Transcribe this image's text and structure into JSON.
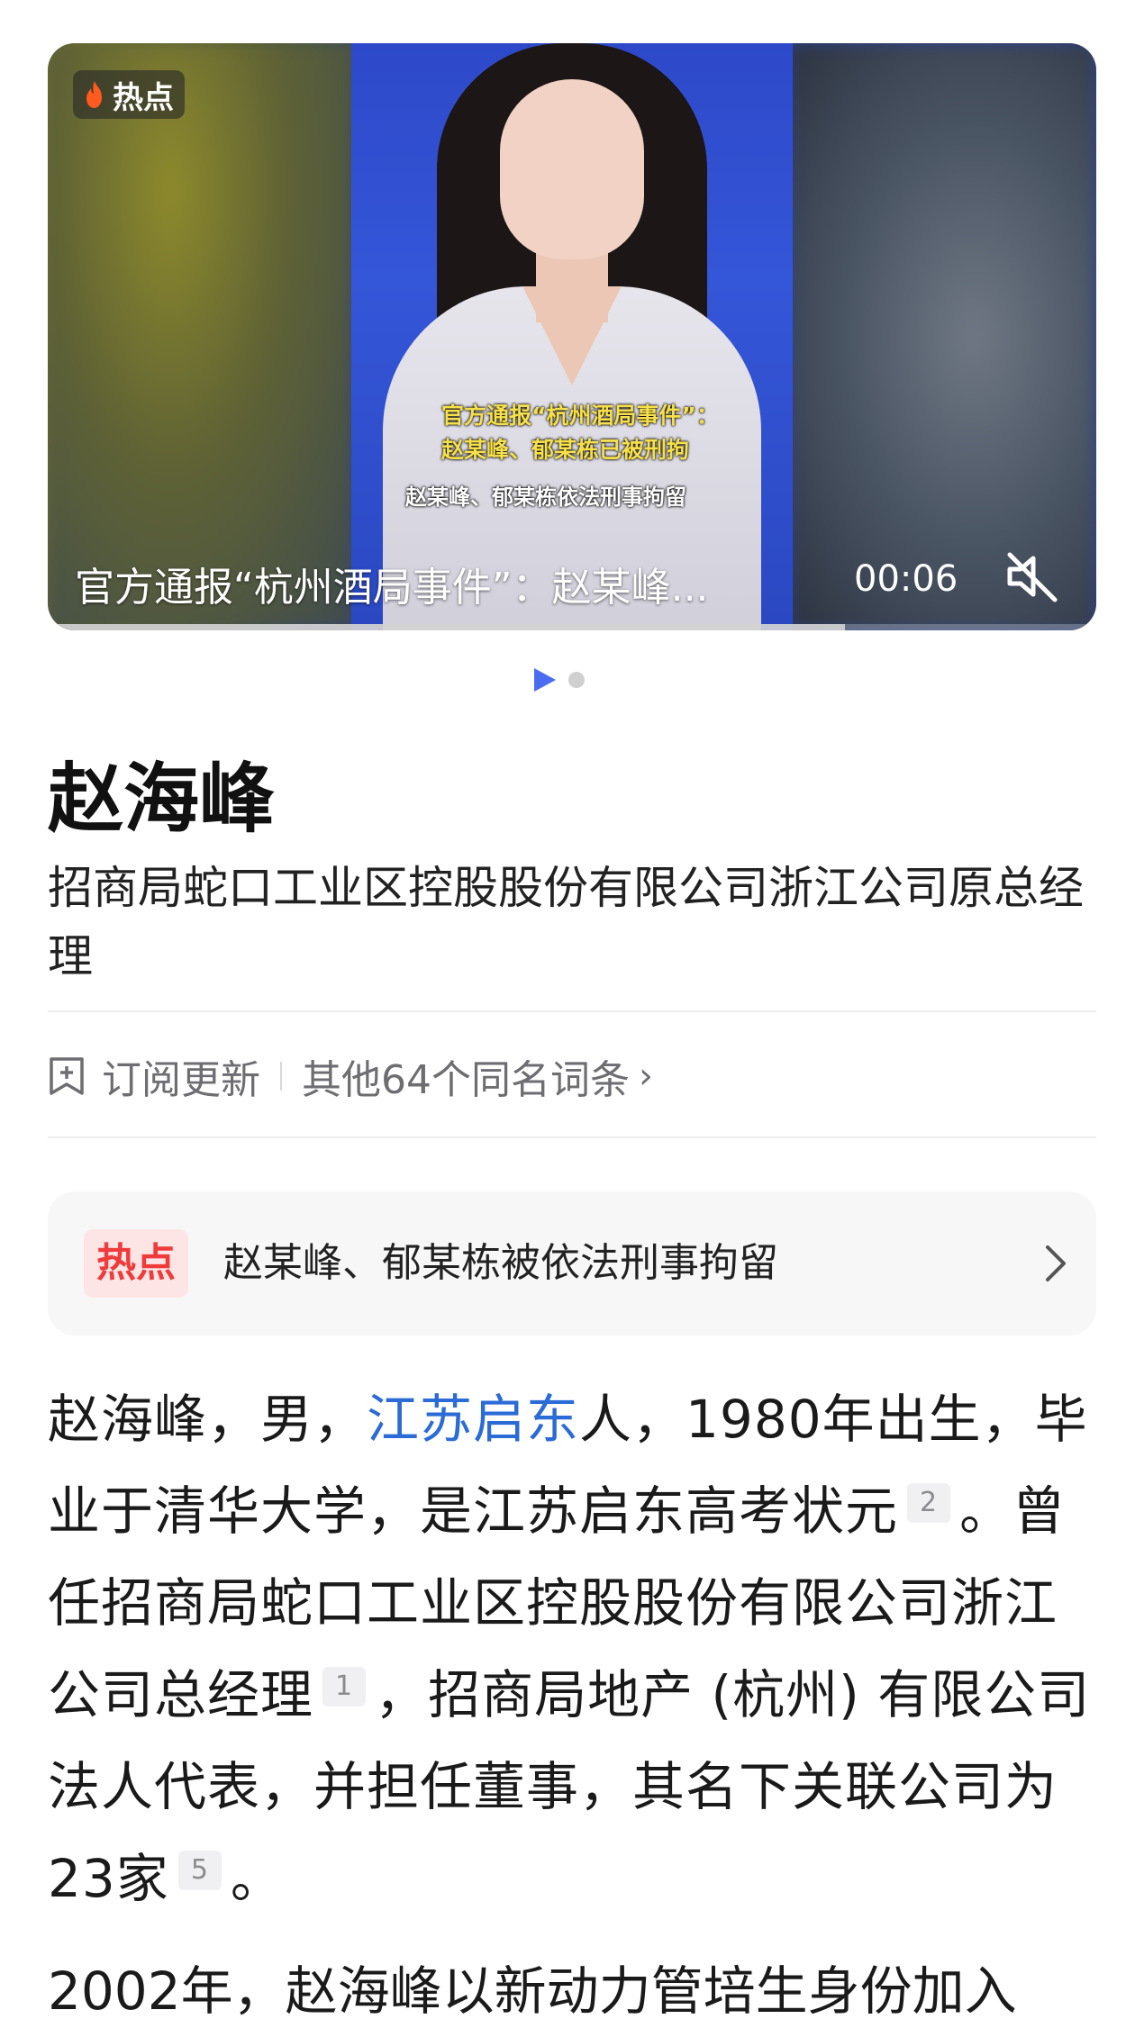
{
  "video": {
    "badge": "热点",
    "caption_line1": "官方通报“杭州酒局事件”：",
    "caption_line2": "赵某峰、郁某栋已被刑拘",
    "caption_sub": "赵某峰、郁某栋依法刑事拘留",
    "title": "官方通报“杭州酒局事件”：赵某峰...",
    "duration": "00:06",
    "progress_fraction": 0.76
  },
  "entry": {
    "name": "赵海峰",
    "subtitle": "招商局蛇口工业区控股股份有限公司浙江公司原总经理",
    "subscribe_label": "订阅更新",
    "other_entries_label": "其他64个同名词条"
  },
  "hot": {
    "tag": "热点",
    "text": "赵某峰、郁某栋被依法刑事拘留"
  },
  "body": {
    "p1_a": "赵海峰，男，",
    "p1_link": "江苏启东",
    "p1_b": "人，1980年出生，毕业于清华大学，是江苏启东高考状元",
    "ref1": "2",
    "p1_c": "。曾任招商局蛇口工业区控股股份有限公司浙江公司总经理",
    "ref2": "1",
    "p1_d": "，招商局地产 (杭州) 有限公司法人代表，并担任董事，其名下关联公司为23家",
    "ref3": "5",
    "p1_e": "。",
    "p2": "2002年，赵海峰以新动力管培生身份加入"
  },
  "colors": {
    "link": "#2b6bd6",
    "hot_tag": "#ef3b3b",
    "pager_active": "#4a6cf0"
  }
}
